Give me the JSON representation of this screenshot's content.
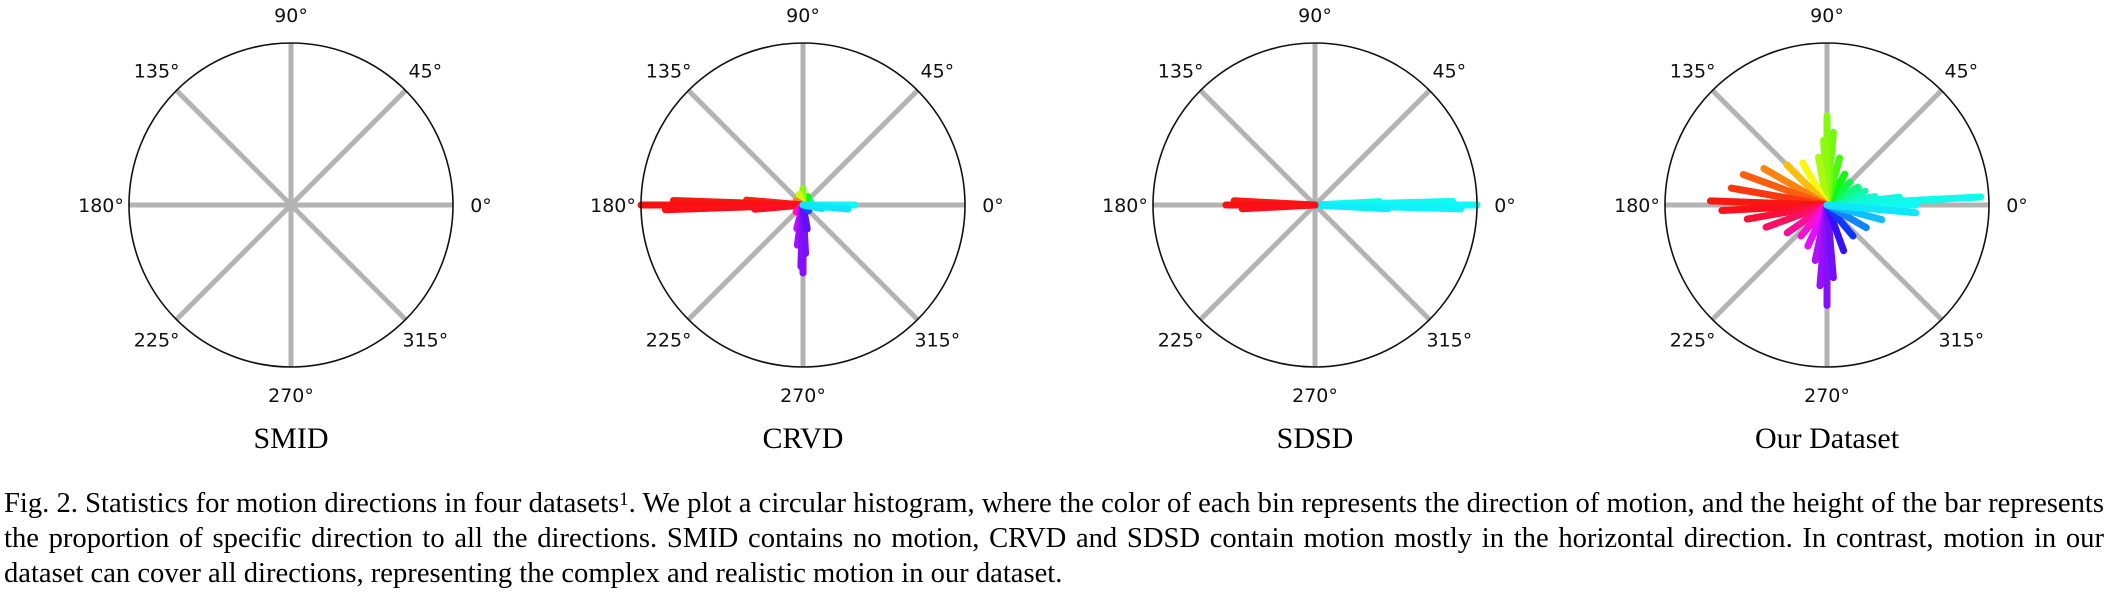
{
  "chart_data": [
    {
      "type": "polar-histogram",
      "title": "SMID",
      "tick_labels": [
        "0°",
        "45°",
        "90°",
        "135°",
        "180°",
        "225°",
        "270°",
        "315°"
      ],
      "bins": []
    },
    {
      "type": "polar-histogram",
      "title": "CRVD",
      "tick_labels": [
        "0°",
        "45°",
        "90°",
        "135°",
        "180°",
        "225°",
        "270°",
        "315°"
      ],
      "bins": [
        {
          "angle": 0,
          "r": 0.32
        },
        {
          "angle": 5,
          "r": 0.06
        },
        {
          "angle": 30,
          "r": 0.05
        },
        {
          "angle": 60,
          "r": 0.06
        },
        {
          "angle": 90,
          "r": 0.1
        },
        {
          "angle": 110,
          "r": 0.07
        },
        {
          "angle": 150,
          "r": 0.05
        },
        {
          "angle": 175,
          "r": 0.35
        },
        {
          "angle": 178,
          "r": 0.8
        },
        {
          "angle": 180,
          "r": 1.0
        },
        {
          "angle": 182,
          "r": 0.85
        },
        {
          "angle": 185,
          "r": 0.3
        },
        {
          "angle": 225,
          "r": 0.06
        },
        {
          "angle": 255,
          "r": 0.15
        },
        {
          "angle": 262,
          "r": 0.25
        },
        {
          "angle": 268,
          "r": 0.38
        },
        {
          "angle": 270,
          "r": 0.42
        },
        {
          "angle": 273,
          "r": 0.3
        },
        {
          "angle": 280,
          "r": 0.15
        },
        {
          "angle": 315,
          "r": 0.05
        },
        {
          "angle": 350,
          "r": 0.12
        },
        {
          "angle": 355,
          "r": 0.28
        }
      ]
    },
    {
      "type": "polar-histogram",
      "title": "SDSD",
      "tick_labels": [
        "0°",
        "45°",
        "90°",
        "135°",
        "180°",
        "225°",
        "270°",
        "315°"
      ],
      "bins": [
        {
          "angle": 0,
          "r": 1.0
        },
        {
          "angle": 1.5,
          "r": 0.85
        },
        {
          "angle": -1.5,
          "r": 0.9
        },
        {
          "angle": 3,
          "r": 0.4
        },
        {
          "angle": -3,
          "r": 0.45
        },
        {
          "angle": 177,
          "r": 0.5
        },
        {
          "angle": 180,
          "r": 0.55
        },
        {
          "angle": 183,
          "r": 0.45
        }
      ]
    },
    {
      "type": "polar-histogram",
      "title": "Our Dataset",
      "tick_labels": [
        "0°",
        "45°",
        "90°",
        "135°",
        "180°",
        "225°",
        "270°",
        "315°"
      ],
      "bins": [
        {
          "angle": 0,
          "r": 0.55
        },
        {
          "angle": 3,
          "r": 0.95
        },
        {
          "angle": 6,
          "r": 0.45
        },
        {
          "angle": 10,
          "r": 0.3
        },
        {
          "angle": 20,
          "r": 0.25
        },
        {
          "angle": 30,
          "r": 0.22
        },
        {
          "angle": 45,
          "r": 0.2
        },
        {
          "angle": 60,
          "r": 0.22
        },
        {
          "angle": 75,
          "r": 0.3
        },
        {
          "angle": 85,
          "r": 0.45
        },
        {
          "angle": 90,
          "r": 0.55
        },
        {
          "angle": 93,
          "r": 0.4
        },
        {
          "angle": 100,
          "r": 0.3
        },
        {
          "angle": 120,
          "r": 0.3
        },
        {
          "angle": 135,
          "r": 0.35
        },
        {
          "angle": 150,
          "r": 0.45
        },
        {
          "angle": 160,
          "r": 0.55
        },
        {
          "angle": 170,
          "r": 0.6
        },
        {
          "angle": 178,
          "r": 0.72
        },
        {
          "angle": 183,
          "r": 0.65
        },
        {
          "angle": 190,
          "r": 0.5
        },
        {
          "angle": 200,
          "r": 0.4
        },
        {
          "angle": 215,
          "r": 0.3
        },
        {
          "angle": 230,
          "r": 0.25
        },
        {
          "angle": 245,
          "r": 0.28
        },
        {
          "angle": 258,
          "r": 0.35
        },
        {
          "angle": 265,
          "r": 0.5
        },
        {
          "angle": 270,
          "r": 0.62
        },
        {
          "angle": 275,
          "r": 0.45
        },
        {
          "angle": 290,
          "r": 0.3
        },
        {
          "angle": 310,
          "r": 0.25
        },
        {
          "angle": 330,
          "r": 0.28
        },
        {
          "angle": 345,
          "r": 0.35
        },
        {
          "angle": 355,
          "r": 0.55
        }
      ]
    }
  ],
  "caption": {
    "prefix": "Fig. 2.  Statistics for motion directions in four datasets",
    "superscript": "1",
    "suffix": ". We plot a circular histogram, where the color of each bin represents the direction of motion, and the height of the bar represents the proportion of specific direction to all the directions. SMID contains no motion, CRVD and SDSD contain motion mostly in the horizontal direction. In contrast, motion in our dataset can cover all directions, representing the complex and realistic motion in our dataset."
  }
}
